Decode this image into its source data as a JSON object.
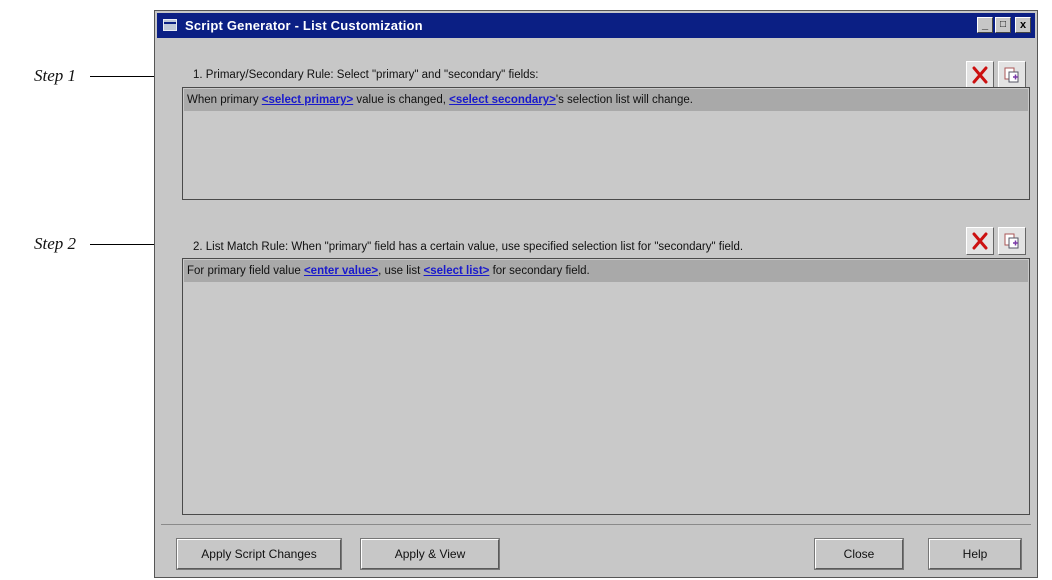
{
  "callouts": {
    "step1": "Step 1",
    "step2": "Step 2"
  },
  "window": {
    "title": "Script Generator - List Customization",
    "controls": {
      "minimize": "_",
      "maximize": "□",
      "close": "x"
    }
  },
  "rule1": {
    "label": "1. Primary/Secondary Rule: Select \"primary\" and \"secondary\" fields:",
    "sentence": {
      "pre": "When primary ",
      "link1": "<select primary>",
      "mid": " value is changed, ",
      "link2": "<select secondary>",
      "post": "'s selection list will change."
    }
  },
  "rule2": {
    "label": "2. List Match Rule:  When \"primary\" field has a certain value, use specified selection list for \"secondary\" field.",
    "sentence": {
      "pre": "For primary field value ",
      "link1": "<enter value>",
      "mid": ", use list ",
      "link2": "<select list>",
      "post": " for secondary field."
    }
  },
  "buttons": {
    "apply_script": "Apply Script Changes",
    "apply_view": "Apply & View",
    "close": "Close",
    "help": "Help"
  },
  "icons": {
    "delete": "delete-x-icon",
    "copy": "copy-add-icon"
  },
  "colors": {
    "titlebar": "#0b1f84",
    "link": "#1a1acc",
    "delete": "#cc1111"
  }
}
